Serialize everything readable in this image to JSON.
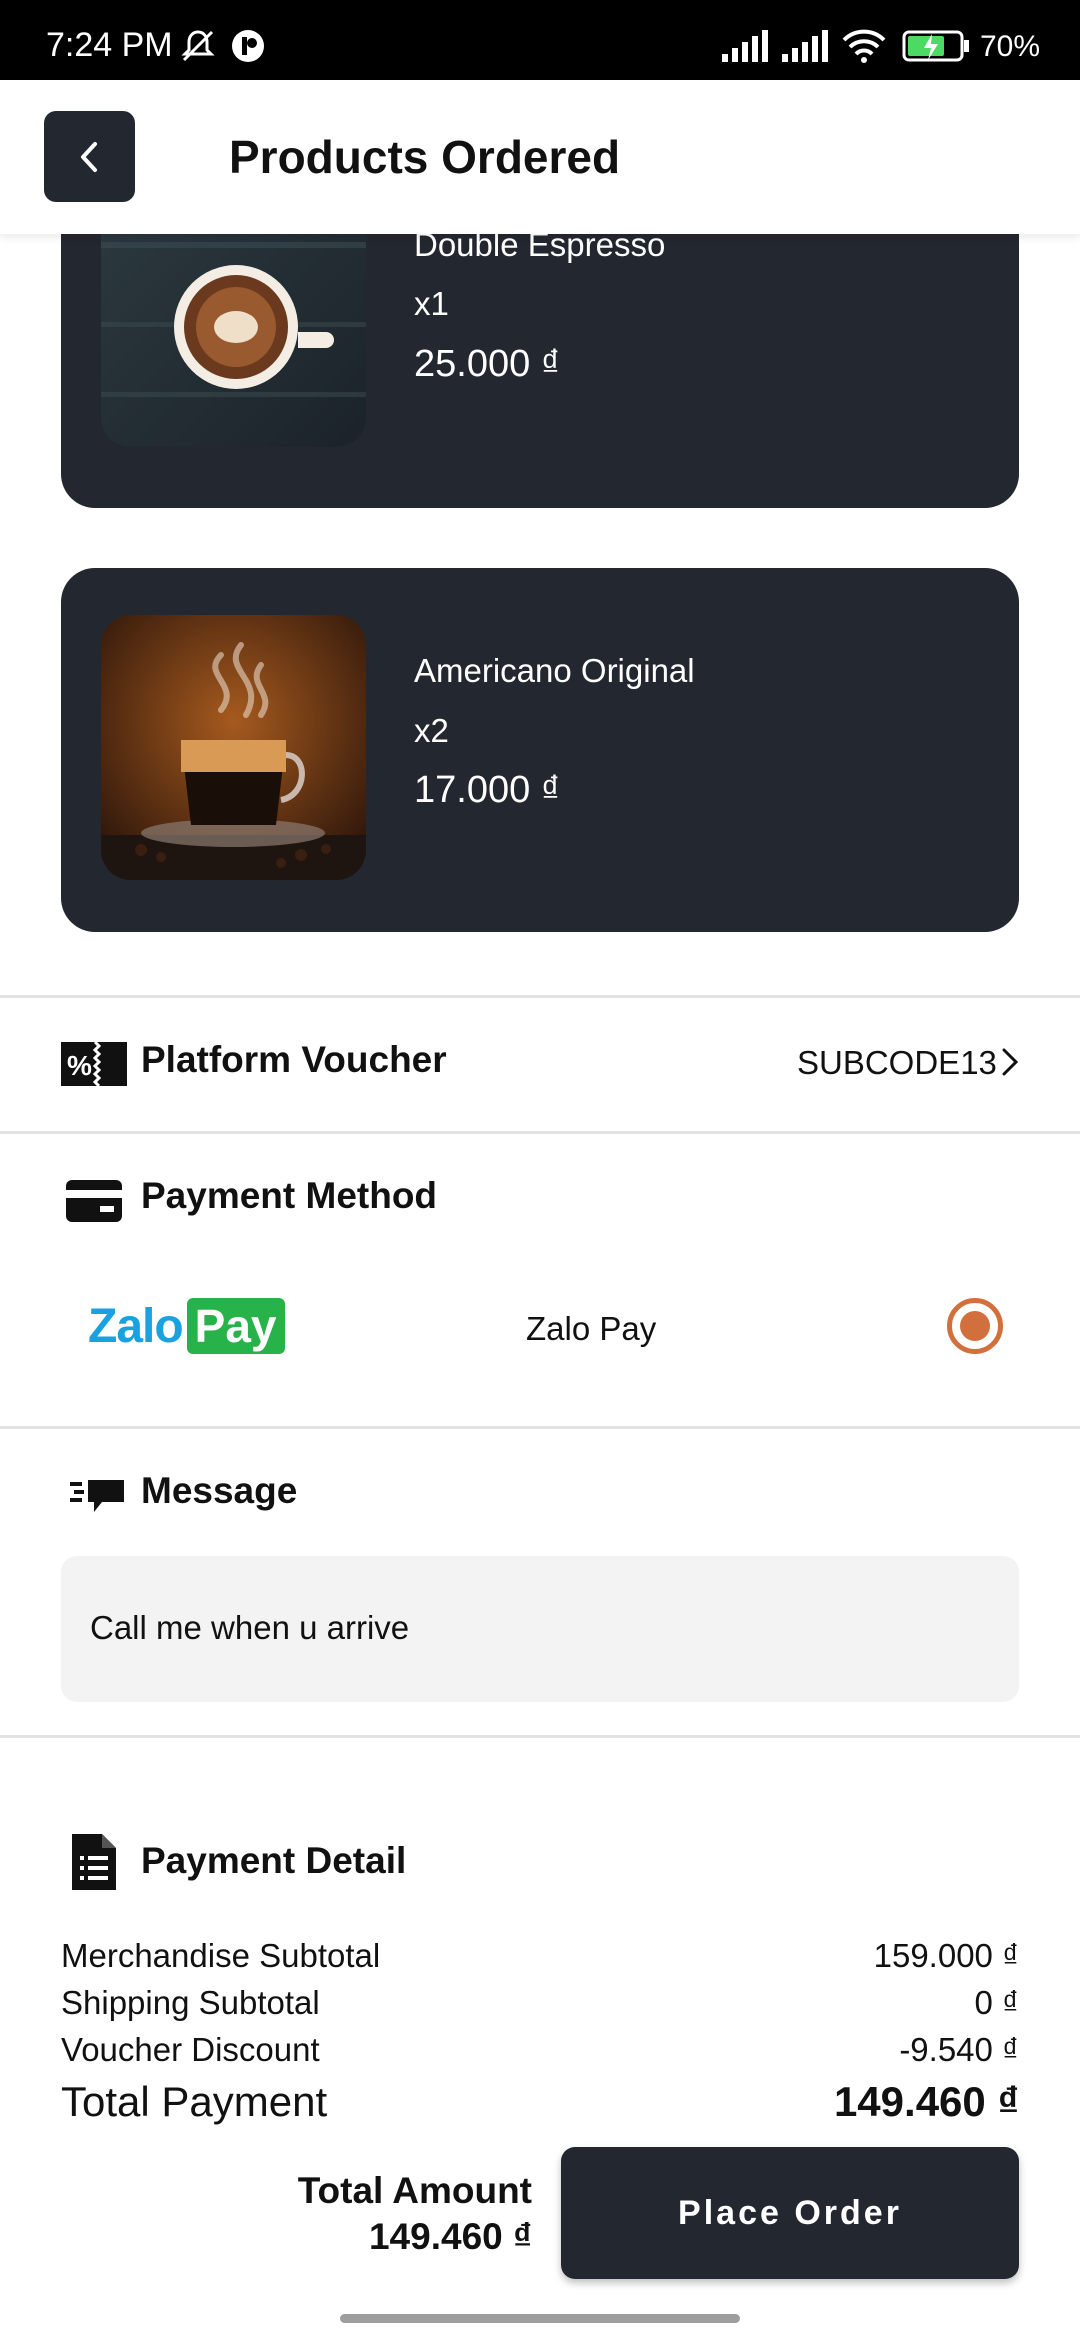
{
  "status_bar": {
    "time": "7:24 PM",
    "battery": "70%"
  },
  "header": {
    "title": "Products Ordered"
  },
  "products": [
    {
      "name": "Double Espresso",
      "qty": "x1",
      "price": "25.000 ₫"
    },
    {
      "name": "Americano Original",
      "qty": "x2",
      "price": "17.000 ₫"
    }
  ],
  "voucher": {
    "title": "Platform Voucher",
    "code": "SUBCODE13"
  },
  "payment_method": {
    "title": "Payment Method",
    "logo_text": "Zalo",
    "logo_badge": "Pay",
    "option_label": "Zalo Pay"
  },
  "message": {
    "title": "Message",
    "value": "Call me when u arrive"
  },
  "payment_detail": {
    "title": "Payment Detail",
    "rows": [
      {
        "label": "Merchandise Subtotal",
        "value": "159.000 ₫"
      },
      {
        "label": "Shipping Subtotal",
        "value": "0 ₫"
      },
      {
        "label": "Voucher Discount",
        "value": "-9.540 ₫"
      }
    ],
    "total_label": "Total Payment",
    "total_value": "149.460 ₫"
  },
  "footer": {
    "total_amount_label": "Total Amount",
    "total_amount_value": "149.460 ₫",
    "place_order_label": "Place Order"
  },
  "colors": {
    "dark": "#23272f",
    "accent": "#d2703d",
    "zalo_blue": "#1aa1e0",
    "zalo_green": "#27b34a"
  }
}
